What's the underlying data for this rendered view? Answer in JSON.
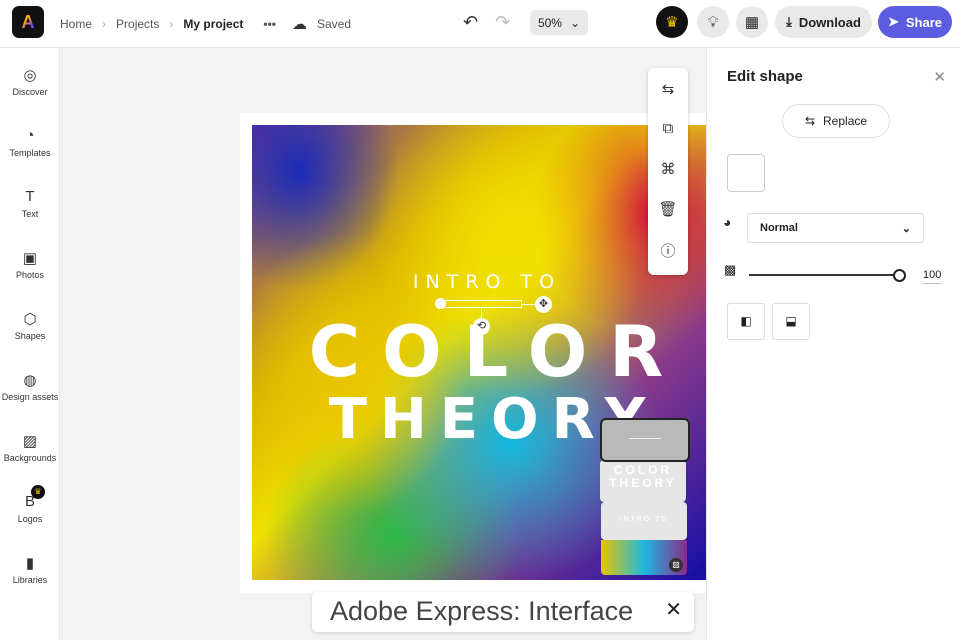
{
  "header": {
    "breadcrumb": [
      "Home",
      "Projects",
      "My project"
    ],
    "more": "•••",
    "save_status": "Saved",
    "zoom": "50%",
    "download": "Download",
    "share": "Share"
  },
  "sidebar": {
    "items": [
      {
        "label": "Discover",
        "icon": "◎"
      },
      {
        "label": "Templates",
        "icon": "◔"
      },
      {
        "label": "Text",
        "icon": "T"
      },
      {
        "label": "Photos",
        "icon": "▣"
      },
      {
        "label": "Shapes",
        "icon": "⬡"
      },
      {
        "label": "Design assets",
        "icon": "◍"
      },
      {
        "label": "Backgrounds",
        "icon": "▨"
      },
      {
        "label": "Logos",
        "icon": "B"
      },
      {
        "label": "Libraries",
        "icon": "▮"
      }
    ]
  },
  "canvas": {
    "line1": "INTRO TO",
    "line2": "COLOR",
    "line3": "THEORY"
  },
  "layers": {
    "l1": "COLOR",
    "l2": "THEORY",
    "l3": "INTRO TO"
  },
  "panel": {
    "title": "Edit shape",
    "replace": "Replace",
    "blend_mode": "Normal",
    "opacity": "100",
    "opacity_value": 100
  },
  "caption": {
    "text": "Adobe Express: Interface"
  },
  "colors": {
    "accent": "#5c5ce0",
    "premium": "#f2c500"
  }
}
